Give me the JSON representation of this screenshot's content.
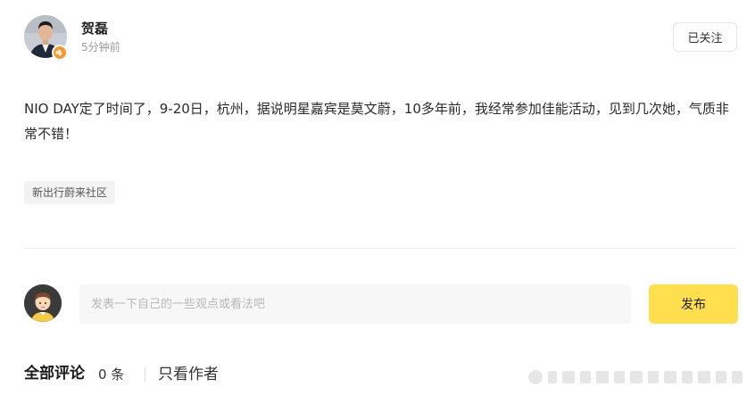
{
  "post": {
    "author_name": "贺磊",
    "time_ago": "5分钟前",
    "follow_label": "已关注",
    "content": "NIO DAY定了时间了，9-20日，杭州，据说明星嘉宾是莫文蔚，10多年前，我经常参加佳能活动，见到几次她，气质非常不错！",
    "topic": "新出行蔚来社区"
  },
  "composer": {
    "placeholder": "发表一下自己的一些观点或看法吧",
    "value": "",
    "publish_label": "发布"
  },
  "comments": {
    "title": "全部评论",
    "count": "0 条",
    "author_only_label": "只看作者"
  },
  "colors": {
    "publish_button": "#ffdf4d",
    "badge": "#f29a2e",
    "tag_background": "#f3f3f3"
  }
}
